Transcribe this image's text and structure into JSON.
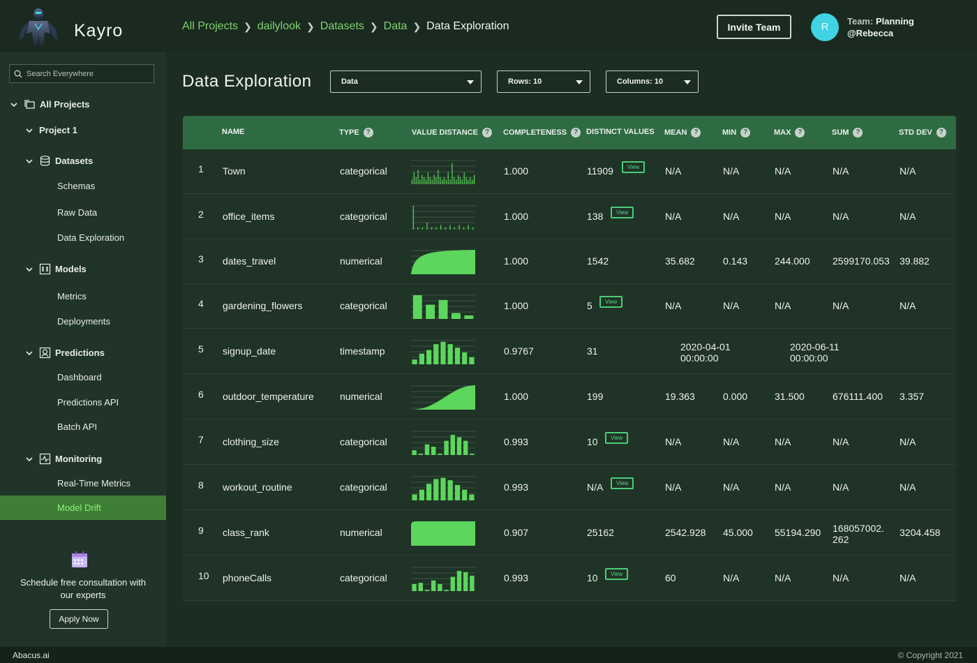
{
  "brand": "Kayro",
  "breadcrumb": [
    "All Projects",
    "dailylook",
    "Datasets",
    "Data",
    "Data Exploration"
  ],
  "header": {
    "invite_label": "Invite Team",
    "avatar_letter": "R",
    "team_key": "Team:",
    "team_name": "Planning",
    "user": "@Rebecca"
  },
  "search": {
    "placeholder": "Search Everywhere"
  },
  "sidebar": {
    "all_projects": "All Projects",
    "project": "Project 1",
    "datasets": "Datasets",
    "schemas": "Schemas",
    "raw_data": "Raw Data",
    "data_exploration": "Data Exploration",
    "models": "Models",
    "metrics": "Metrics",
    "deployments": "Deployments",
    "predictions": "Predictions",
    "dashboard": "Dashboard",
    "predictions_api": "Predictions API",
    "batch_api": "Batch API",
    "monitoring": "Monitoring",
    "realtime_metrics": "Real-Time Metrics",
    "model_drift": "Model Drift"
  },
  "cta": {
    "text": "Schedule free consultation with our experts",
    "button": "Apply Now"
  },
  "page_title": "Data Exploration",
  "filters": {
    "dataset": "Data",
    "rows": "Rows:  10",
    "columns": "Columns:  10"
  },
  "columns": {
    "name": "NAME",
    "type": "TYPE",
    "value_distance": "VALUE DISTANCE",
    "completeness": "COMPLETENESS",
    "distinct_values": "DISTINCT VALUES",
    "mean": "MEAN",
    "min": "MIN",
    "max": "MAX",
    "sum": "SUM",
    "std_dev": "STD DEV"
  },
  "help_glyph": "?",
  "view_label": "View",
  "accent_color": "#5cd65c",
  "rows": [
    {
      "idx": "1",
      "name": "Town",
      "type": "categorical",
      "completeness": "1.000",
      "distinct": "11909",
      "view": true,
      "mean": "N/A",
      "min": "N/A",
      "max": "N/A",
      "sum": "N/A",
      "std": "N/A",
      "chart": "sparse",
      "bars": [
        0.2,
        0.5,
        0.3,
        0.6,
        0.2,
        0.4,
        0.3,
        0.2,
        0.5,
        0.3,
        0.2,
        0.4,
        0.3,
        0.6,
        0.3,
        0.2,
        0.3,
        0.2,
        0.5,
        0.2,
        0.9,
        0.3,
        0.2,
        0.4,
        0.3,
        0.2,
        0.5,
        0.3,
        0.2,
        0.3,
        0.2,
        0.4
      ]
    },
    {
      "idx": "2",
      "name": "office_items",
      "type": "categorical",
      "completeness": "1.000",
      "distinct": "138",
      "view": true,
      "mean": "N/A",
      "min": "N/A",
      "max": "N/A",
      "sum": "N/A",
      "std": "N/A",
      "chart": "sparse",
      "bars": [
        1,
        0.1,
        0.1,
        0.3,
        0.1,
        0.1,
        0.2,
        0.1,
        0.2,
        0.1,
        0.2,
        0.1,
        0.2,
        0.1
      ]
    },
    {
      "idx": "3",
      "name": "dates_travel",
      "type": "numerical",
      "completeness": "1.000",
      "distinct": "1542",
      "view": false,
      "mean": "35.682",
      "min": "0.143",
      "max": "244.000",
      "sum": "2599170.053",
      "std": "39.882",
      "chart": "area",
      "curve": "log"
    },
    {
      "idx": "4",
      "name": "gardening_flowers",
      "type": "categorical",
      "completeness": "1.000",
      "distinct": "5",
      "view": true,
      "mean": "N/A",
      "min": "N/A",
      "max": "N/A",
      "sum": "N/A",
      "std": "N/A",
      "chart": "bars",
      "bars": [
        1,
        0.6,
        0.8,
        0.25,
        0.15
      ]
    },
    {
      "idx": "5",
      "name": "signup_date",
      "type": "timestamp",
      "completeness": "0.9767",
      "distinct": "31",
      "view": false,
      "mean": "2020-04-01\n00:00:00",
      "min": "",
      "max": "2020-06-11\n00:00:00",
      "sum": "",
      "std": "",
      "chart": "bars",
      "bars": [
        0.2,
        0.45,
        0.6,
        0.85,
        0.95,
        0.85,
        0.7,
        0.5,
        0.3
      ]
    },
    {
      "idx": "6",
      "name": "outdoor_temperature",
      "type": "numerical",
      "completeness": "1.000",
      "distinct": "199",
      "view": false,
      "mean": "19.363",
      "min": "0.000",
      "max": "31.500",
      "sum": "676111.400",
      "std": "3.357",
      "chart": "area",
      "curve": "s"
    },
    {
      "idx": "7",
      "name": "clothing_size",
      "type": "categorical",
      "completeness": "0.993",
      "distinct": "10",
      "view": true,
      "mean": "N/A",
      "min": "N/A",
      "max": "N/A",
      "sum": "N/A",
      "std": "N/A",
      "chart": "bars",
      "bars": [
        0.2,
        0.05,
        0.45,
        0.35,
        0.05,
        0.6,
        0.85,
        0.75,
        0.6,
        0.05
      ]
    },
    {
      "idx": "8",
      "name": "workout_routine",
      "type": "categorical",
      "completeness": "0.993",
      "distinct": "N/A",
      "view": true,
      "mean": "N/A",
      "min": "N/A",
      "max": "N/A",
      "sum": "N/A",
      "std": "N/A",
      "chart": "bars",
      "bars": [
        0.25,
        0.45,
        0.7,
        0.9,
        0.95,
        0.85,
        0.65,
        0.45,
        0.25
      ]
    },
    {
      "idx": "9",
      "name": "class_rank",
      "type": "numerical",
      "completeness": "0.907",
      "distinct": "25162",
      "view": false,
      "mean": "2542.928",
      "min": "45.000",
      "max": "55194.290",
      "sum": "168057002.\n262",
      "std": "3204.458",
      "chart": "area",
      "curve": "flat"
    },
    {
      "idx": "10",
      "name": "phoneCalls",
      "type": "categorical",
      "completeness": "0.993",
      "distinct": "10",
      "view": true,
      "mean": "60",
      "min": "N/A",
      "max": "N/A",
      "sum": "N/A",
      "std": "N/A",
      "chart": "bars",
      "bars": [
        0.3,
        0.35,
        0.05,
        0.45,
        0.3,
        0.05,
        0.6,
        0.85,
        0.8,
        0.65
      ]
    }
  ],
  "footer": {
    "left": "Abacus.ai",
    "right": "© Copyright 2021"
  }
}
